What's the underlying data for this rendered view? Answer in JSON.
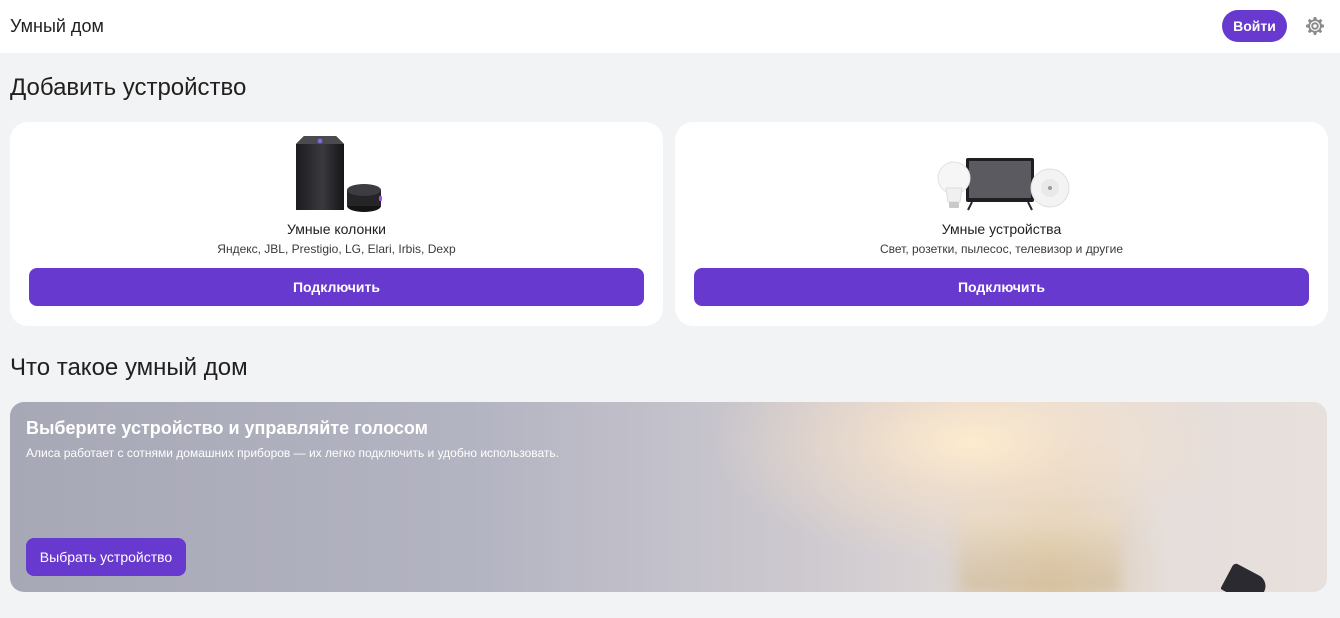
{
  "header": {
    "title": "Умный дом",
    "login_label": "Войти",
    "settings_icon": "gear-icon"
  },
  "add_section": {
    "title": "Добавить устройство",
    "cards": [
      {
        "title": "Умные колонки",
        "subtitle": "Яндекс, JBL, Prestigio, LG, Elari, Irbis, Dexp",
        "button": "Подключить",
        "image": "smart-speakers-image"
      },
      {
        "title": "Умные устройства",
        "subtitle": "Свет, розетки, пылесос, телевизор и другие",
        "button": "Подключить",
        "image": "smart-devices-image"
      }
    ]
  },
  "about_section": {
    "title": "Что такое умный дом",
    "banner": {
      "title": "Выберите устройство и управляйте голосом",
      "subtitle": "Алиса работает с сотнями домашних приборов — их легко подключить и удобно использовать.",
      "button": "Выбрать устройство"
    }
  },
  "colors": {
    "accent": "#6839cf",
    "background": "#f2f3f5",
    "card": "#ffffff",
    "text": "#21201f"
  }
}
